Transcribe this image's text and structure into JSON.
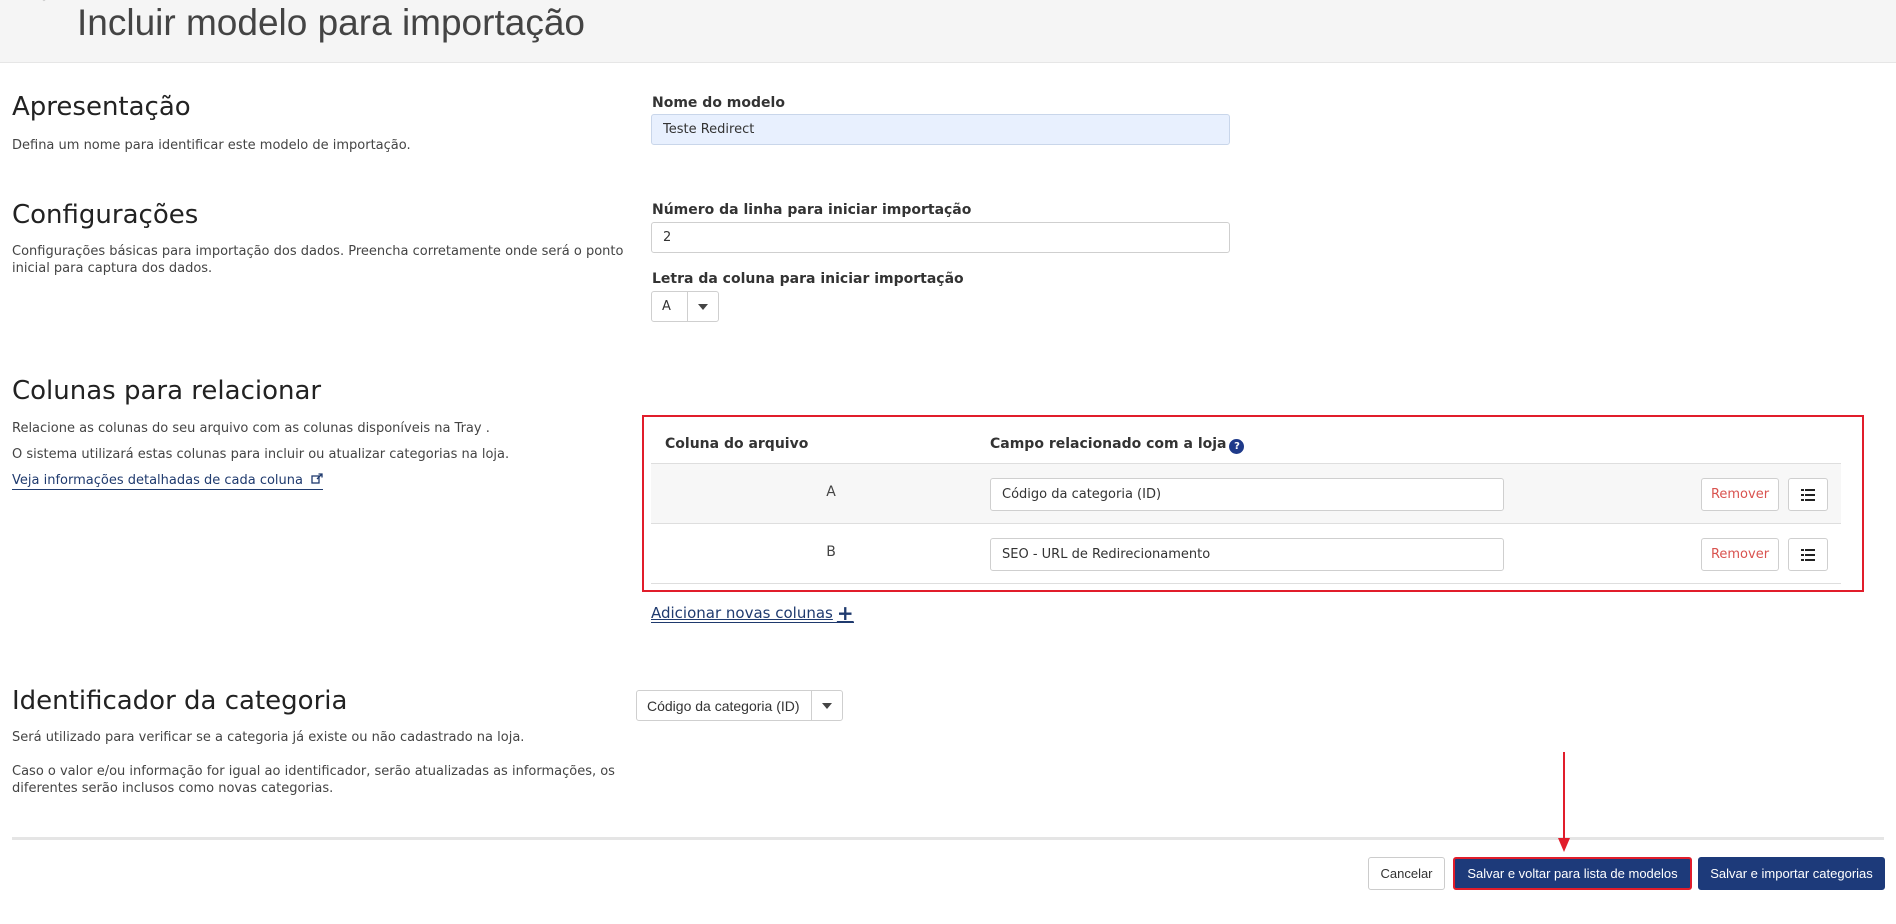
{
  "header": {
    "title": "Incluir modelo para importação"
  },
  "presentation": {
    "title": "Apresentação",
    "description": "Defina um nome para identificar este modelo de importação.",
    "model_name_label": "Nome do modelo",
    "model_name_value": "Teste Redirect"
  },
  "settings": {
    "title": "Configurações",
    "description_line1": "Configurações básicas para importação dos dados. Preencha corretamente onde será o ponto",
    "description_line2": "inicial para captura dos dados.",
    "start_row_label": "Número da linha para iniciar importação",
    "start_row_value": "2",
    "start_column_label": "Letra da coluna para iniciar importação",
    "start_column_value": "A"
  },
  "columns": {
    "title": "Colunas para relacionar",
    "description_line1": "Relacione as colunas do seu arquivo com as colunas disponíveis na Tray .",
    "description_line2": "O sistema utilizará estas colunas para incluir ou atualizar categorias na loja.",
    "details_link": "Veja informações detalhadas de cada coluna",
    "header_file_column": "Coluna do arquivo",
    "header_store_field": "Campo relacionado com a loja",
    "help_icon": "question-circle-icon",
    "rows": [
      {
        "letter": "A",
        "field": "Código da categoria (ID)",
        "remove_label": "Remover"
      },
      {
        "letter": "B",
        "field": "SEO - URL de Redirecionamento",
        "remove_label": "Remover"
      }
    ],
    "add_link": "Adicionar novas colunas"
  },
  "identifier": {
    "title": "Identificador da categoria",
    "description_line1": "Será utilizado para verificar se a categoria já existe ou não cadastrado na loja.",
    "description_line2": "Caso o valor e/ou informação for igual ao identificador, serão atualizadas as informações, os",
    "description_line3": "diferentes serão inclusos como novas categorias.",
    "selected_value": "Código da categoria (ID)"
  },
  "footer": {
    "cancel_label": "Cancelar",
    "save_back_label": "Salvar e voltar para lista de modelos",
    "save_import_label": "Salvar e importar categorias"
  },
  "colors": {
    "primary": "#1d3a7a",
    "highlight": "#e11d2b",
    "remove": "#d9534f",
    "input_filled": "#e8f0fe"
  }
}
